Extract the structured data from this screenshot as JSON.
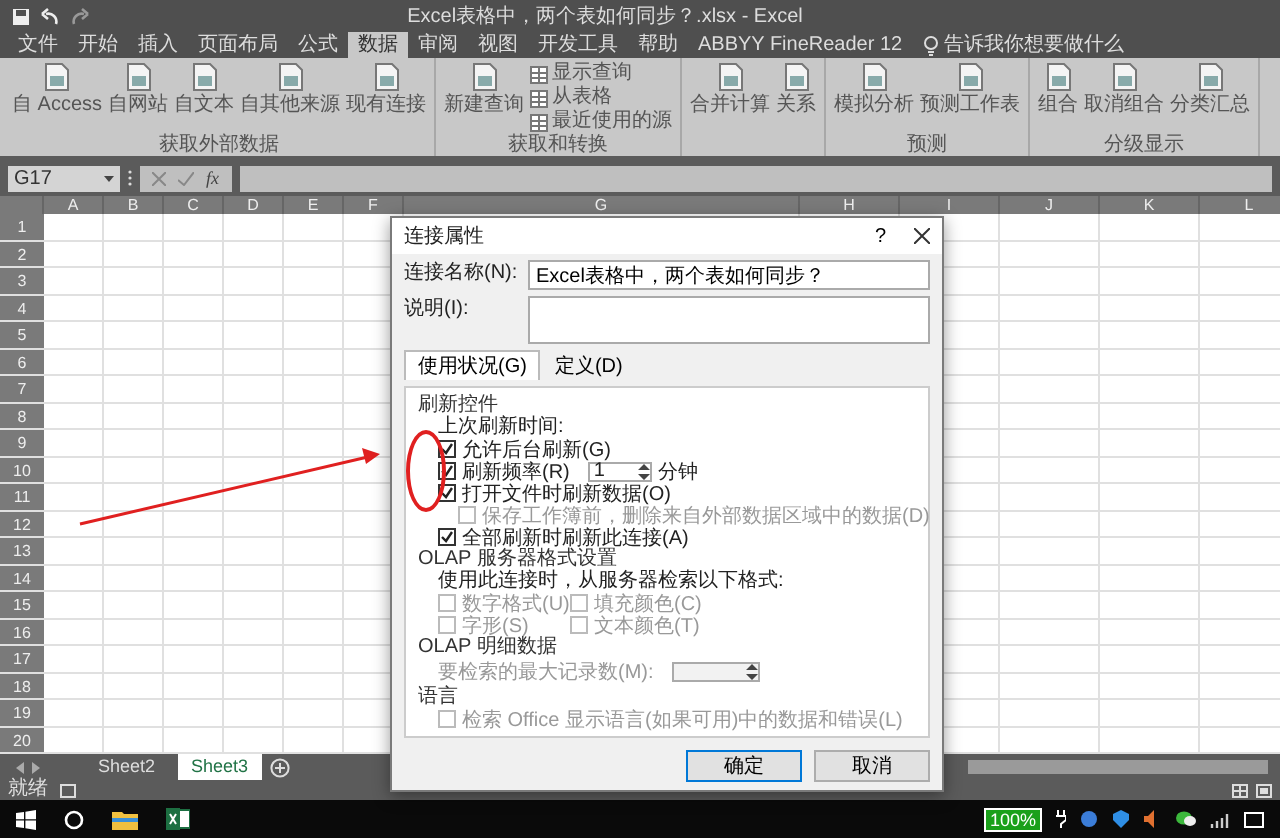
{
  "window": {
    "title": "Excel表格中，两个表如何同步？.xlsx - Excel"
  },
  "ribbon_tabs": [
    {
      "label": "文件",
      "selected": false
    },
    {
      "label": "开始",
      "selected": false
    },
    {
      "label": "插入",
      "selected": false
    },
    {
      "label": "页面布局",
      "selected": false
    },
    {
      "label": "公式",
      "selected": false
    },
    {
      "label": "数据",
      "selected": true
    },
    {
      "label": "审阅",
      "selected": false
    },
    {
      "label": "视图",
      "selected": false
    },
    {
      "label": "开发工具",
      "selected": false
    },
    {
      "label": "帮助",
      "selected": false
    },
    {
      "label": "ABBYY FineReader 12",
      "selected": false
    }
  ],
  "tell_me": {
    "placeholder": "告诉我你想要做什么"
  },
  "ribbon_groups": [
    {
      "label": "获取外部数据",
      "buttons": [
        {
          "kind": "large",
          "label": "自 Access"
        },
        {
          "kind": "large",
          "label": "自网站"
        },
        {
          "kind": "large",
          "label": "自文本"
        },
        {
          "kind": "large",
          "label": "自其他来源"
        },
        {
          "kind": "large",
          "label": "现有连接"
        }
      ]
    },
    {
      "label": "获取和转换",
      "buttons": [
        {
          "kind": "large",
          "label": "新建查询"
        },
        {
          "kind": "small",
          "label": "显示查询"
        },
        {
          "kind": "small",
          "label": "从表格"
        },
        {
          "kind": "small",
          "label": "最近使用的源"
        }
      ]
    },
    {
      "buttons": [
        {
          "kind": "large",
          "label": "合并计算"
        },
        {
          "kind": "large",
          "label": "关系"
        }
      ]
    },
    {
      "label": "预测",
      "buttons": [
        {
          "kind": "large",
          "label": "模拟分析"
        },
        {
          "kind": "large",
          "label": "预测工作表"
        }
      ]
    },
    {
      "label": "分级显示",
      "buttons": [
        {
          "kind": "large",
          "label": "组合"
        },
        {
          "kind": "large",
          "label": "取消组合"
        },
        {
          "kind": "large",
          "label": "分类汇总"
        }
      ]
    }
  ],
  "formula_bar": {
    "name_box": "G17",
    "function_label": "fx"
  },
  "columns": [
    "A",
    "B",
    "C",
    "D",
    "E",
    "F",
    "G",
    "H",
    "I",
    "J",
    "K",
    "L"
  ],
  "rows": [
    "1",
    "2",
    "3",
    "4",
    "5",
    "6",
    "7",
    "8",
    "9",
    "10",
    "11",
    "12",
    "13",
    "14",
    "15",
    "16",
    "17",
    "18",
    "19",
    "20"
  ],
  "sheets": [
    {
      "name": "Sheet2",
      "selected": false
    },
    {
      "name": "Sheet3",
      "selected": true
    }
  ],
  "status_bar": {
    "text": "就绪"
  },
  "dialog": {
    "title": "连接属性",
    "help": "?",
    "name_label": "连接名称(N):",
    "name_value": "Excel表格中，两个表如何同步？",
    "description_label": "说明(I):",
    "tabs": [
      {
        "label": "使用状况(G)",
        "selected": true
      },
      {
        "label": "定义(D)",
        "selected": false
      }
    ],
    "refresh": {
      "title": "刷新控件",
      "last_refresh": "上次刷新时间:",
      "options": [
        {
          "label": "允许后台刷新(G)",
          "checked": true,
          "disabled": false
        },
        {
          "label": "刷新频率(R)",
          "checked": true,
          "disabled": false,
          "spin_value": "1",
          "unit": "分钟"
        },
        {
          "label": "打开文件时刷新数据(O)",
          "checked": true,
          "disabled": false,
          "children": [
            {
              "label": "保存工作簿前，删除来自外部数据区域中的数据(D)",
              "checked": false,
              "disabled": true
            }
          ]
        },
        {
          "label": "全部刷新时刷新此连接(A)",
          "checked": true,
          "disabled": false
        }
      ]
    },
    "olap_format": {
      "title": "OLAP 服务器格式设置",
      "note": "使用此连接时，从服务器检索以下格式:",
      "options": [
        {
          "label": "数字格式(U)",
          "checked": false,
          "disabled": true
        },
        {
          "label": "填充颜色(C)",
          "checked": false,
          "disabled": true
        },
        {
          "label": "字形(S)",
          "checked": false,
          "disabled": true
        },
        {
          "label": "文本颜色(T)",
          "checked": false,
          "disabled": true
        }
      ]
    },
    "olap_detail": {
      "title": "OLAP 明细数据",
      "label": "要检索的最大记录数(M):",
      "disabled": true
    },
    "language": {
      "title": "语言",
      "option": {
        "label": "检索 Office 显示语言(如果可用)中的数据和错误(L)",
        "checked": false,
        "disabled": true
      }
    },
    "buttons": [
      {
        "label": "确定",
        "default": true
      },
      {
        "label": "取消",
        "default": false
      }
    ]
  },
  "taskbar": {
    "battery": "100%"
  }
}
